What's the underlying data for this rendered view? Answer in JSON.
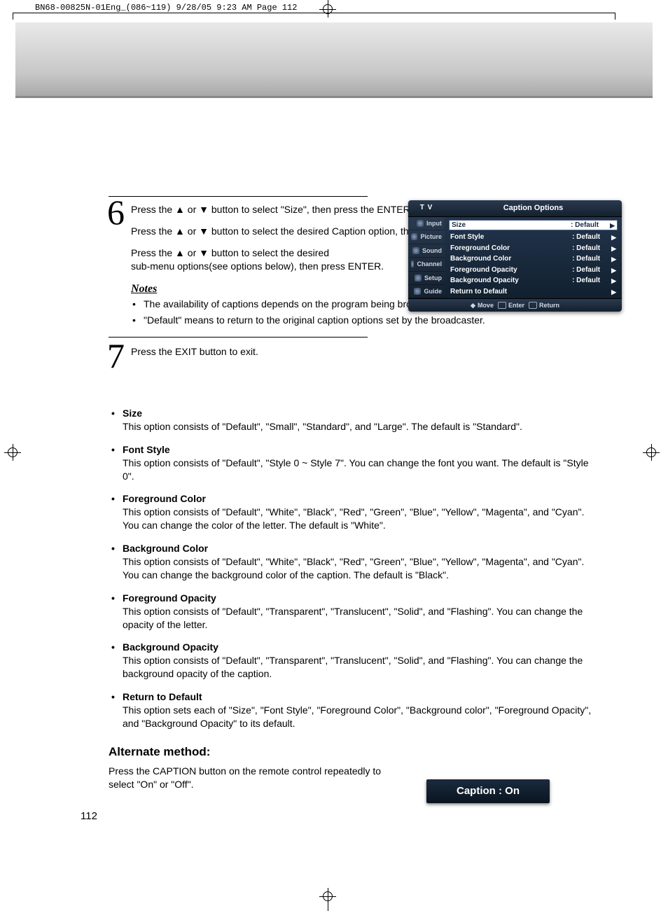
{
  "print_header": "BN68-00825N-01Eng_(086~119)  9/28/05  9:23 AM  Page 112",
  "page_number": "112",
  "step6": {
    "p1a": "Press the ",
    "p1b": " or ",
    "p1c": " button to select \"Size\", then press the ENTER button.",
    "p2a": "Press the ",
    "p2b": " or ",
    "p2c": " button to select the desired Caption option, then press the ENTER button.",
    "p3a": "Press the ",
    "p3b": " or ",
    "p3c": " button to select the desired",
    "p3d": "sub-menu options(see options below), then press ENTER."
  },
  "notes_heading": "Notes",
  "notes": [
    "The availability of captions depends on the program being broadcast.",
    "\"Default\" means to return to the original caption options set by the broadcaster."
  ],
  "step7": "Press the EXIT button to exit.",
  "options": [
    {
      "title": "Size",
      "desc": "This option consists of \"Default\", \"Small\", \"Standard\", and \"Large\". The default is \"Standard\"."
    },
    {
      "title": "Font Style",
      "desc": "This option consists of \"Default\", \"Style 0 ~ Style 7\". You can change the font you want. The default is \"Style 0\"."
    },
    {
      "title": "Foreground Color",
      "desc": "This option consists of \"Default\", \"White\", \"Black\", \"Red\", \"Green\", \"Blue\", \"Yellow\", \"Magenta\", and \"Cyan\". You can change the color of the letter. The default is \"White\"."
    },
    {
      "title": "Background Color",
      "desc": "This option consists of \"Default\", \"White\", \"Black\", \"Red\", \"Green\", \"Blue\", \"Yellow\", \"Magenta\", and \"Cyan\". You can change the background color of the caption. The default is \"Black\"."
    },
    {
      "title": "Foreground Opacity",
      "desc": "This option consists of \"Default\", \"Transparent\", \"Translucent\", \"Solid\", and \"Flashing\". You can change the opacity of the letter."
    },
    {
      "title": "Background Opacity",
      "desc": "This option consists of \"Default\", \"Transparent\", \"Translucent\", \"Solid\", and \"Flashing\". You can change the background opacity of the caption."
    },
    {
      "title": "Return to Default",
      "desc": "This option sets each of \"Size\", \"Font Style\", \"Foreground Color\", \"Background color\", \"Foreground Opacity\", and \"Background Opacity\" to its default."
    }
  ],
  "alternate": {
    "heading": "Alternate method:",
    "text": "Press the CAPTION button on the remote control repeatedly to select \"On\" or \"Off\"."
  },
  "osd": {
    "tv": "T V",
    "title": "Caption Options",
    "side": [
      "Input",
      "Picture",
      "Sound",
      "Channel",
      "Setup",
      "Guide"
    ],
    "rows": [
      {
        "label": "Size",
        "value": ": Default",
        "sel": true
      },
      {
        "label": "Font Style",
        "value": ": Default",
        "sel": false
      },
      {
        "label": "Foreground Color",
        "value": ": Default",
        "sel": false
      },
      {
        "label": "Background Color",
        "value": ": Default",
        "sel": false
      },
      {
        "label": "Foreground Opacity",
        "value": ": Default",
        "sel": false
      },
      {
        "label": "Background Opacity",
        "value": ": Default",
        "sel": false
      },
      {
        "label": "Return to Default",
        "value": "",
        "sel": false
      }
    ],
    "footer": {
      "move": "Move",
      "enter": "Enter",
      "return": "Return"
    }
  },
  "caption_box": "Caption : On",
  "arrows": {
    "up": "▲",
    "down": "▼",
    "right": "▶",
    "updown": "◆"
  }
}
